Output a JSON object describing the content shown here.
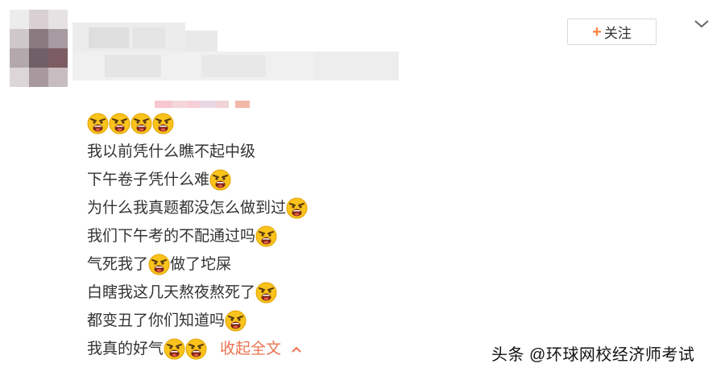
{
  "header": {
    "follow_label": "关注"
  },
  "post": {
    "lines": [
      {
        "text": "",
        "emoji_after": 4
      },
      {
        "text": "我以前凭什么瞧不起中级",
        "emoji_after": 0
      },
      {
        "text": "下午卷子凭什么难",
        "emoji_after": 1
      },
      {
        "text": "为什么我真题都没怎么做到过",
        "emoji_after": 1
      },
      {
        "text": "我们下午考的不配通过吗",
        "emoji_after": 1
      },
      {
        "text": "气死我了",
        "emoji_after": 1,
        "text_after": "做了坨屎"
      },
      {
        "text": "白瞎我这几天熬夜熬死了",
        "emoji_after": 1
      },
      {
        "text": "都变丑了你们知道吗",
        "emoji_after": 1
      },
      {
        "text": "我真的好气",
        "emoji_after": 2
      }
    ],
    "collapse_label": "收起全文",
    "emoji_name": "angry-face-emoji"
  },
  "watermark": {
    "text": "头条 @环球网校经济师考试"
  },
  "colors": {
    "accent": "#eb7350",
    "plus": "#ff8140",
    "text": "#333333"
  }
}
